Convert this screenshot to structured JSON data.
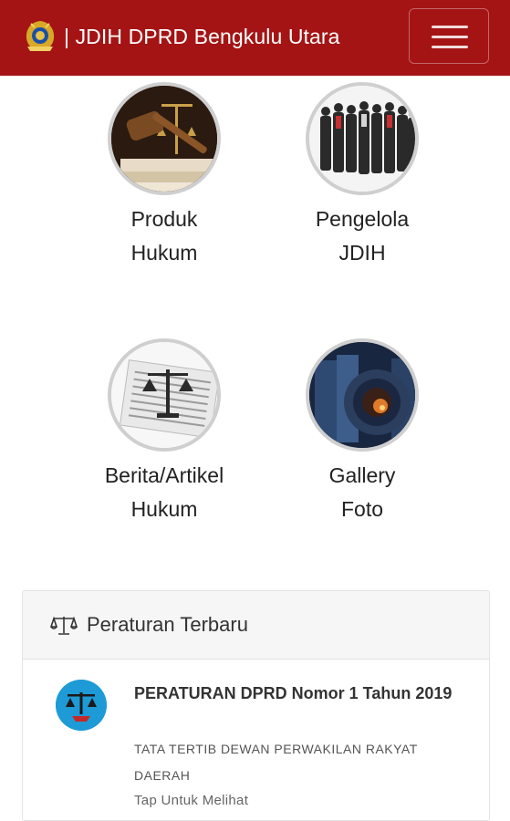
{
  "header": {
    "title": "| JDIH DPRD Bengkulu Utara",
    "logo_icon": "dprd-emblem-icon",
    "menu_icon": "hamburger-icon",
    "bg_color": "#a41414"
  },
  "menu": [
    {
      "line1": "Produk",
      "line2": "Hukum",
      "icon": "gavel-icon"
    },
    {
      "line1": "Pengelola",
      "line2": "JDIH",
      "icon": "people-icon"
    },
    {
      "line1": "Berita/Artikel",
      "line2": "Hukum",
      "icon": "newspaper-scale-icon"
    },
    {
      "line1": "Gallery",
      "line2": "Foto",
      "icon": "camera-lens-icon"
    }
  ],
  "latest": {
    "title": "Peraturan Terbaru",
    "icon": "balance-scale-icon",
    "items": [
      {
        "title": "PERATURAN DPRD Nomor 1 Tahun 2019",
        "description": "TATA TERTIB DEWAN PERWAKILAN RAKYAT DAERAH",
        "hint": "Tap Untuk Melihat",
        "icon": "justice-scale-icon",
        "icon_color": "#1e9ad6"
      }
    ]
  }
}
